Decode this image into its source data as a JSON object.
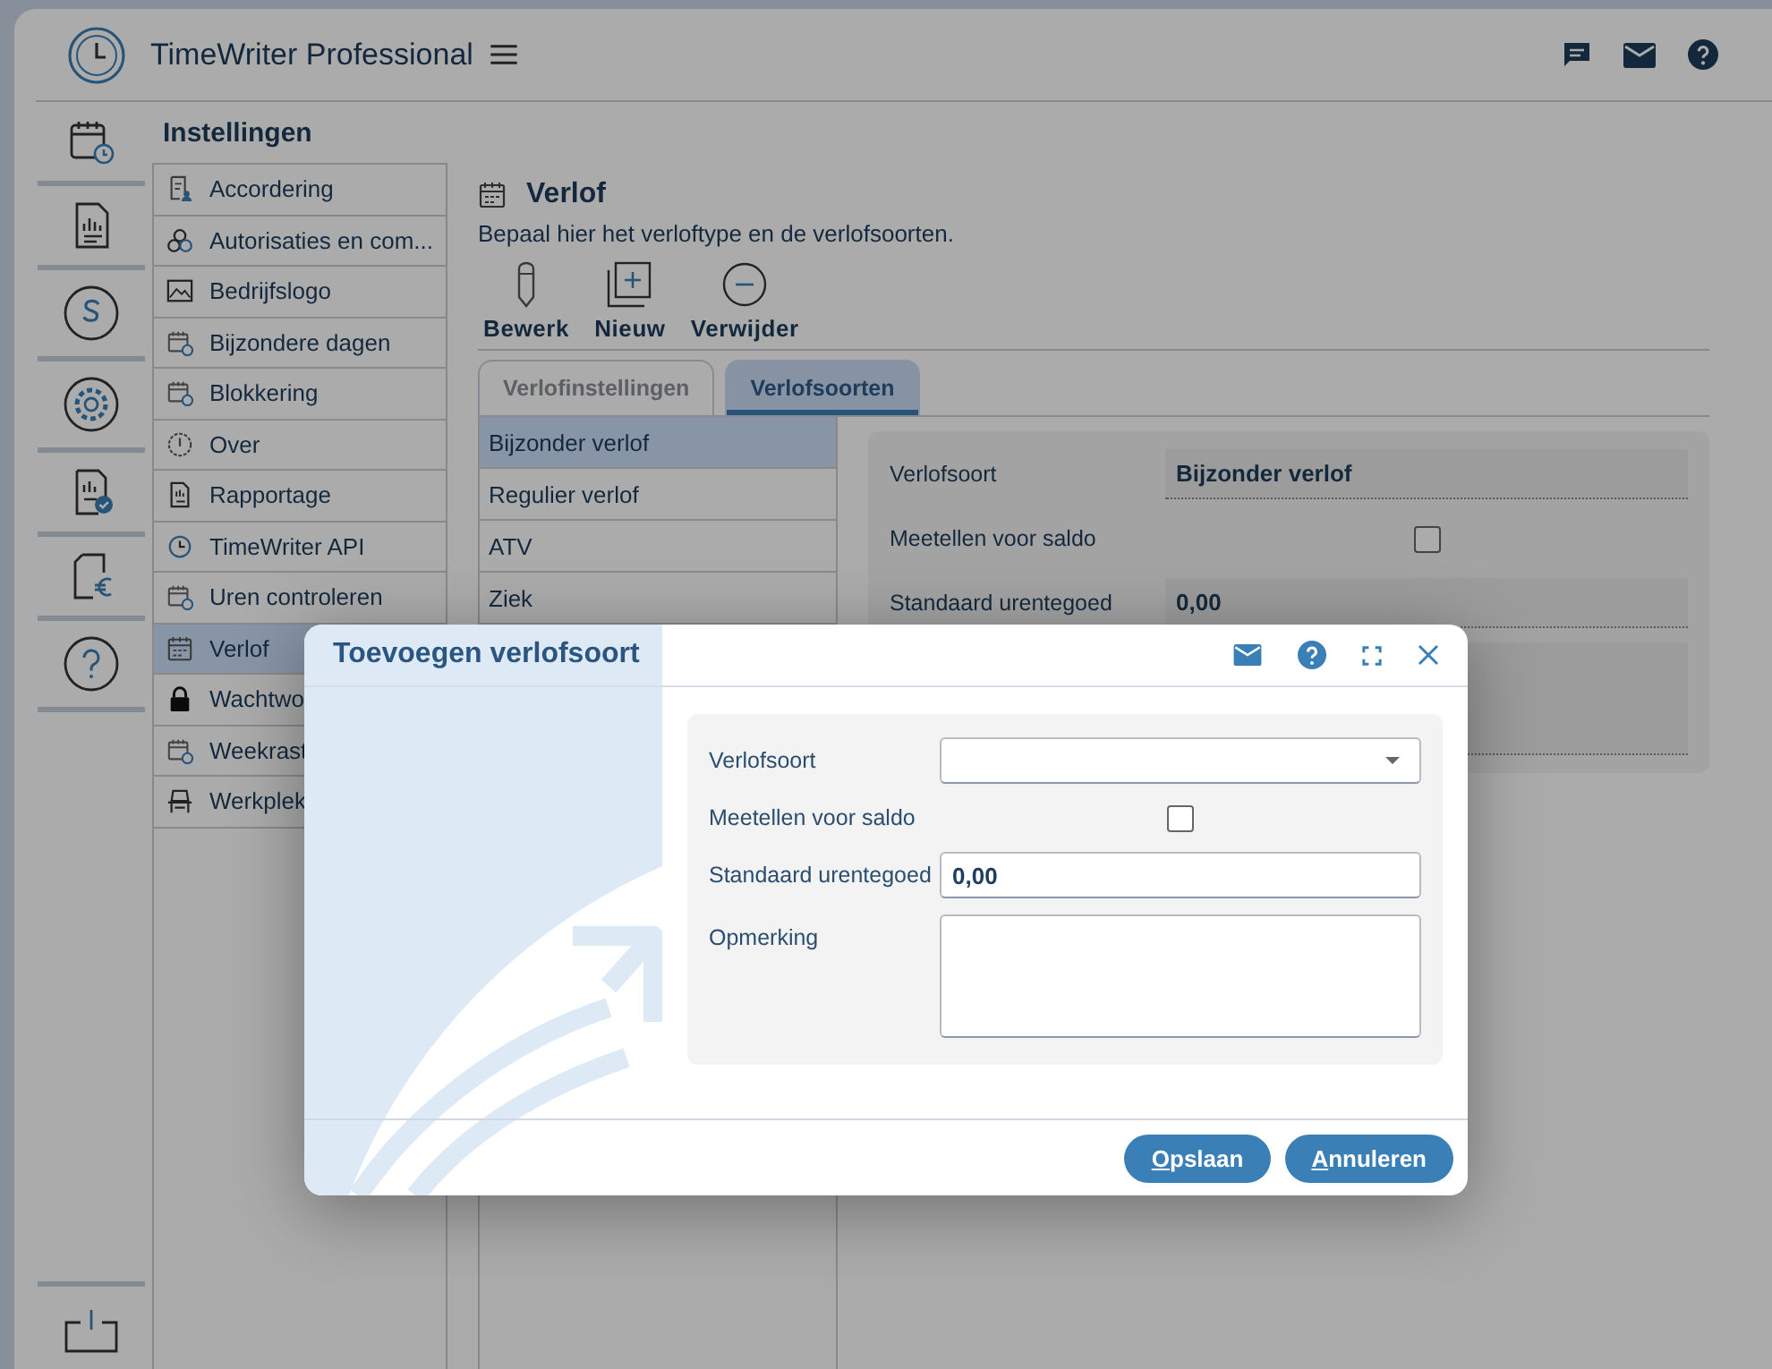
{
  "app": {
    "title": "TimeWriter Professional"
  },
  "settings": {
    "title": "Instellingen",
    "items": [
      {
        "label": "Accordering",
        "kind": "approve",
        "selected": false
      },
      {
        "label": "Autorisaties en com...",
        "kind": "people",
        "selected": false
      },
      {
        "label": "Bedrijfslogo",
        "kind": "image",
        "selected": false
      },
      {
        "label": "Bijzondere dagen",
        "kind": "calendar",
        "selected": false
      },
      {
        "label": "Blokkering",
        "kind": "calendar",
        "selected": false
      },
      {
        "label": "Over",
        "kind": "info",
        "selected": false
      },
      {
        "label": "Rapportage",
        "kind": "report",
        "selected": false
      },
      {
        "label": "TimeWriter API",
        "kind": "clock",
        "selected": false
      },
      {
        "label": "Uren controleren",
        "kind": "calendar",
        "selected": false
      },
      {
        "label": "Verlof",
        "kind": "grid",
        "selected": true
      },
      {
        "label": "Wachtwo",
        "kind": "lock",
        "selected": false
      },
      {
        "label": "Weekrast",
        "kind": "calendar",
        "selected": false
      },
      {
        "label": "Werkplek",
        "kind": "desk",
        "selected": false
      }
    ]
  },
  "page": {
    "title": "Verlof",
    "description": "Bepaal hier het verloftype en de verlofsoorten.",
    "toolbar": [
      {
        "label": "Bewerk",
        "kind": "edit"
      },
      {
        "label": "Nieuw",
        "kind": "new"
      },
      {
        "label": "Verwijder",
        "kind": "delete"
      }
    ],
    "tabs": [
      {
        "label": "Verlofinstellingen",
        "selected": false
      },
      {
        "label": "Verlofsoorten",
        "selected": true
      }
    ],
    "types": [
      {
        "label": "Bijzonder verlof",
        "selected": true
      },
      {
        "label": "Regulier verlof",
        "selected": false
      },
      {
        "label": "ATV",
        "selected": false
      },
      {
        "label": "Ziek",
        "selected": false
      }
    ],
    "details": [
      {
        "kind": "text",
        "label": "Verlofsoort",
        "value": "Bijzonder verlof"
      },
      {
        "kind": "checkbox",
        "label": "Meetellen voor saldo",
        "checked": false
      },
      {
        "kind": "text",
        "label": "Standaard urentegoed",
        "value": "0,00"
      }
    ]
  },
  "dialog": {
    "title": "Toevoegen verlofsoort",
    "fields": [
      {
        "kind": "select",
        "label": "Verlofsoort"
      },
      {
        "kind": "checkbox",
        "label": "Meetellen voor saldo",
        "checked": false
      },
      {
        "kind": "input",
        "label": "Standaard urentegoed",
        "value": "0,00"
      },
      {
        "kind": "textarea",
        "label": "Opmerking"
      }
    ],
    "buttons": [
      "Opslaan",
      "Annuleren"
    ]
  }
}
